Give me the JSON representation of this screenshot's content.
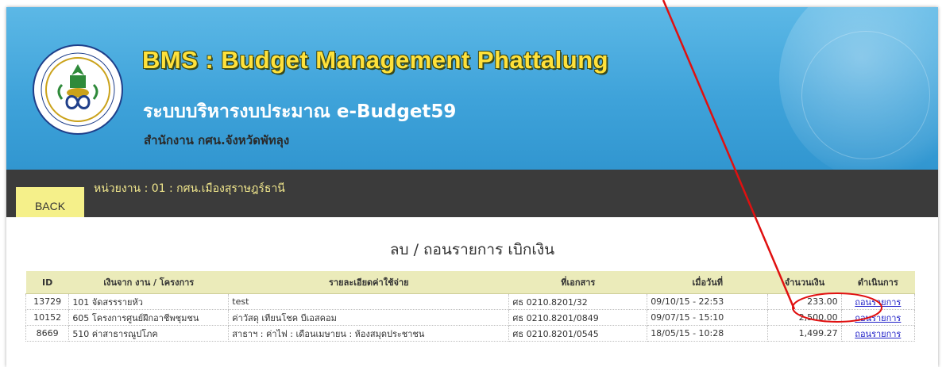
{
  "header": {
    "title_en": "BMS : Budget Management Phattalung",
    "title_th": "ระบบบริหารงบประมาณ e-Budget59",
    "office": "สำนักงาน กศน.จังหวัดพัทลุง"
  },
  "nav": {
    "back_label": "BACK",
    "unit_text": "หน่วยงาน : 01 : กศน.เมืองสุราษฎร์ธานี"
  },
  "page_title": "ลบ / ถอนรายการ เบิกเงิน",
  "table": {
    "headers": [
      "ID",
      "เงินจาก งาน / โครงการ",
      "รายละเอียดค่าใช้จ่าย",
      "ที่เอกสาร",
      "เมื่อวันที่",
      "จำนวนเงิน",
      "ดำเนินการ"
    ],
    "rows": [
      {
        "id": "13729",
        "project": "101 จัดสรรรายหัว",
        "detail": "test",
        "doc": "ศธ 0210.8201/32",
        "date": "09/10/15 - 22:53",
        "amount": "233.00",
        "action": "ถอนรายการ"
      },
      {
        "id": "10152",
        "project": "605 โครงการศูนย์ฝึกอาชีพชุมชน",
        "detail": "ค่าวัสดุ เทียนโชค บีเอสคอม",
        "doc": "ศธ 0210.8201/0849",
        "date": "09/07/15 - 15:10",
        "amount": "2,500.00",
        "action": "ถอนรายการ"
      },
      {
        "id": "8669",
        "project": "510 ค่าสาธารณูปโภค",
        "detail": "สาธาฯ : ค่าไฟ : เดือนเมษายน : ห้องสมุดประชาชน",
        "doc": "ศธ 0210.8201/0545",
        "date": "18/05/15 - 10:28",
        "amount": "1,499.27",
        "action": "ถอนรายการ"
      }
    ]
  },
  "colors": {
    "header_blue": "#3fa3da",
    "title_yellow": "#ffe13a",
    "nav_dark": "#3b3b3b",
    "back_button": "#f5f08a",
    "table_header": "#ebebba",
    "link_blue": "#2020c8",
    "annotation_red": "#e01010"
  },
  "icons": {
    "logo": "ministry-seal-icon"
  }
}
